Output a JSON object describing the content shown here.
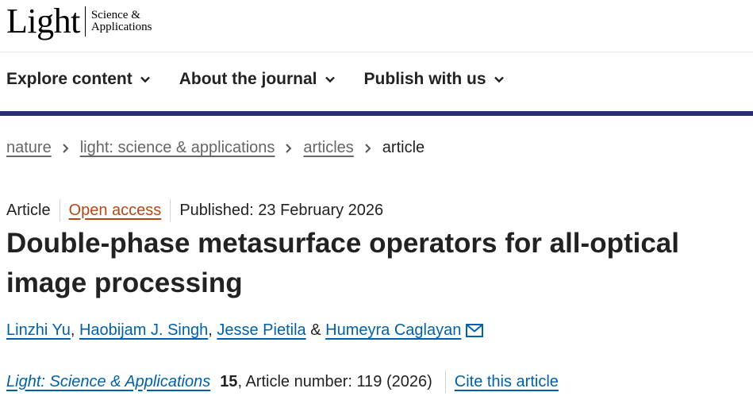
{
  "header": {
    "logo_word": "Light",
    "logo_sub_line1": "Science &",
    "logo_sub_line2": "Applications"
  },
  "nav": {
    "items": [
      {
        "label": "Explore content"
      },
      {
        "label": "About the journal"
      },
      {
        "label": "Publish with us"
      }
    ]
  },
  "breadcrumb": {
    "items": [
      {
        "label": "nature"
      },
      {
        "label": "light: science & applications"
      },
      {
        "label": "articles"
      }
    ],
    "current": "article"
  },
  "meta": {
    "type": "Article",
    "access": "Open access",
    "published": "Published: 23 February 2026"
  },
  "title": {
    "line1": "Double-phase metasurface operators for all-optical",
    "line2": "image processing"
  },
  "authors": {
    "list": [
      {
        "name": "Linzhi Yu"
      },
      {
        "name": "Haobijam J. Singh"
      },
      {
        "name": "Jesse Pietila"
      },
      {
        "name": "Humeyra Caglayan"
      }
    ],
    "sep_comma": ",",
    "sep_and": "&"
  },
  "citation": {
    "journal": "Light: Science & Applications",
    "volume": "15",
    "rest": ", Article number: 119 (2026)",
    "cite_label": "Cite this article"
  },
  "colors": {
    "nav_bar": "#29297a",
    "link": "#0061a8",
    "open_access": "#b74616"
  },
  "icons": {
    "nav_chevron": "chevron-down-icon",
    "breadcrumb_sep": "chevron-right-icon",
    "author_contact": "email-icon"
  }
}
